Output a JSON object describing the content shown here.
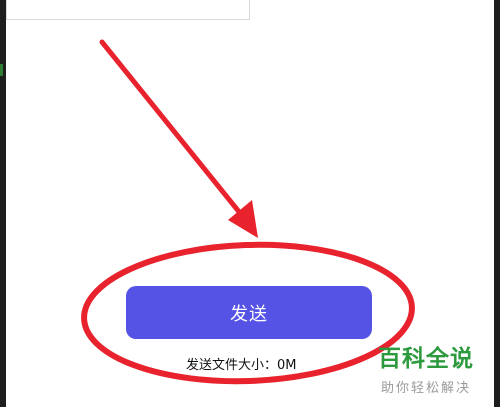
{
  "send_button": {
    "label": "发送",
    "color": "#5453e6"
  },
  "file_size": {
    "label": "发送文件大小：",
    "value": "0M"
  },
  "annotation": {
    "color": "#e8232e"
  },
  "watermark": {
    "title": "百科全说",
    "subtitle": "助你轻松解决",
    "title_color": "#2e9a3e",
    "subtitle_color": "#9a9a9a"
  }
}
